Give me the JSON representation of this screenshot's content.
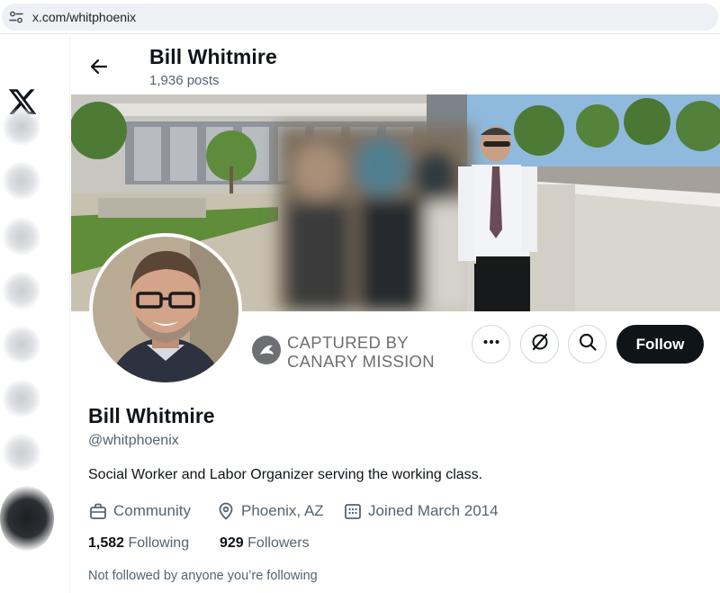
{
  "browser": {
    "url": "x.com/whitphoenix"
  },
  "header": {
    "name": "Bill Whitmire",
    "posts": "1,936 posts"
  },
  "watermark": {
    "line1": "CAPTURED BY",
    "line2": "CANARY MISSION"
  },
  "actions": {
    "follow_label": "Follow"
  },
  "profile": {
    "name": "Bill Whitmire",
    "handle": "@whitphoenix",
    "bio": "Social Worker and Labor Organizer serving the working class.",
    "category": "Community",
    "location": "Phoenix, AZ",
    "joined": "Joined March 2014",
    "following_count": "1,582",
    "following_label": "Following",
    "followers_count": "929",
    "followers_label": "Followers",
    "not_followed": "Not followed by anyone you’re following"
  },
  "icons": {
    "site_info": "tune-icon",
    "logo": "x-logo-icon",
    "back": "arrow-left-icon",
    "more": "more-dots-icon",
    "grok": "grok-icon",
    "search": "search-icon",
    "category": "briefcase-icon",
    "location": "location-pin-icon",
    "joined": "calendar-icon",
    "watermark": "canary-bird-icon"
  },
  "colors": {
    "text_primary": "#0f1419",
    "text_secondary": "#536471",
    "follow_bg": "#0f1419",
    "follow_text": "#ffffff",
    "border": "#cfd9de"
  }
}
